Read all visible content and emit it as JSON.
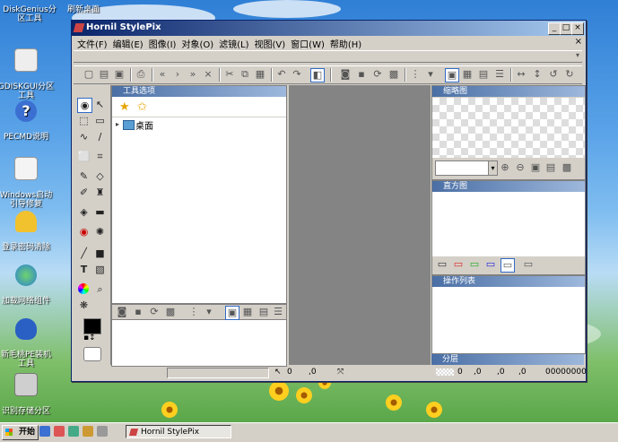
{
  "desktop": {
    "top_labels": [
      "DiskGenius分\n区工具",
      "刷新桌面"
    ],
    "icons": [
      {
        "label": "GDISKGUI分区\n工具",
        "icon": "tool-icon"
      },
      {
        "label": "PECMD说明",
        "icon": "help-icon"
      },
      {
        "label": "Windows启动\n引导修复",
        "icon": "wrench-icon"
      },
      {
        "label": "登录密码清除",
        "icon": "key-icon"
      },
      {
        "label": "加载网络组件",
        "icon": "globe-icon"
      },
      {
        "label": "新毛桃PE装机\n工具",
        "icon": "peach-icon"
      },
      {
        "label": "识别存储分区",
        "icon": "drive-icon"
      }
    ]
  },
  "window": {
    "title": "Hornil StylePix",
    "menu": [
      "文件(F)",
      "编辑(E)",
      "图像(I)",
      "对象(O)",
      "滤镜(L)",
      "视图(V)",
      "窗口(W)",
      "帮助(H)"
    ],
    "tool_options_title": "工具选项",
    "tree_item": "桌面",
    "thumbnail_title": "缩略图",
    "histogram_title": "直方图",
    "operations_title": "操作列表",
    "layers_title": "分层",
    "status": {
      "x": "0",
      "y": ",0",
      "layer_a": "0",
      "layer_b": ",0",
      "layer_c": ",0",
      "layer_d": ",0",
      "color": "00000000"
    }
  },
  "taskbar": {
    "start_label": "开始",
    "task_label": "Hornil StylePix"
  }
}
